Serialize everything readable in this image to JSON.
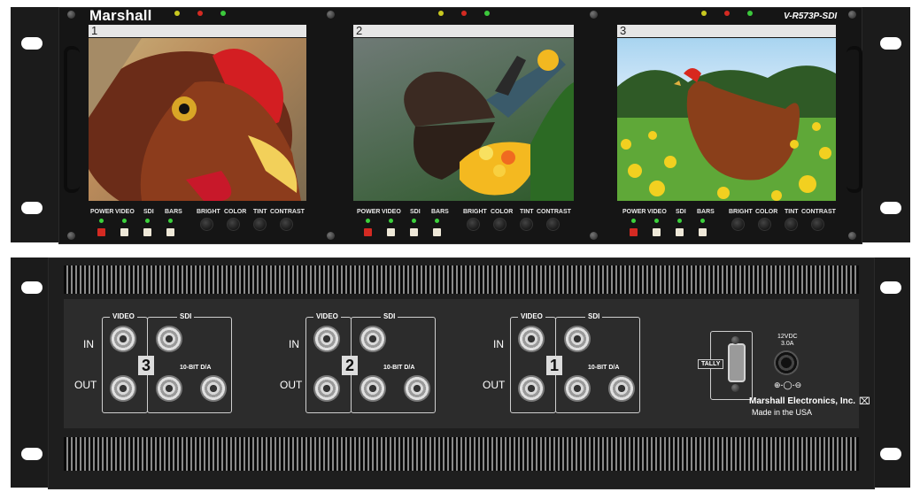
{
  "front_panel": {
    "brand": "Marshall",
    "model": "V-R573P-SDI",
    "channels": [
      {
        "number": "1",
        "image": "rooster-closeup"
      },
      {
        "number": "2",
        "image": "butterfly-on-flowers"
      },
      {
        "number": "3",
        "image": "hen-in-meadow"
      }
    ],
    "control_labels": {
      "power": "POWER",
      "video": "VIDEO",
      "sdi": "SDI",
      "bars": "BARS",
      "bright": "BRIGHT",
      "color": "COLOR",
      "tint": "TINT",
      "contrast": "CONTRAST"
    },
    "colors": {
      "power_button": "#d42a22",
      "status_led": "#3cd23c",
      "led_yellow": "#c8c820",
      "led_red": "#d42a22",
      "led_green": "#3cc83c"
    }
  },
  "rear_panel": {
    "inputs": [
      {
        "number": "3"
      },
      {
        "number": "2"
      },
      {
        "number": "1"
      }
    ],
    "labels": {
      "video": "VIDEO",
      "sdi": "SDI",
      "in": "IN",
      "out": "OUT",
      "da": "10-BIT D/A",
      "tally": "TALLY",
      "power_spec": "12VDC",
      "power_amp": "3.0A",
      "manufacturer": "Marshall Electronics, Inc.",
      "origin": "Made in the USA"
    }
  }
}
